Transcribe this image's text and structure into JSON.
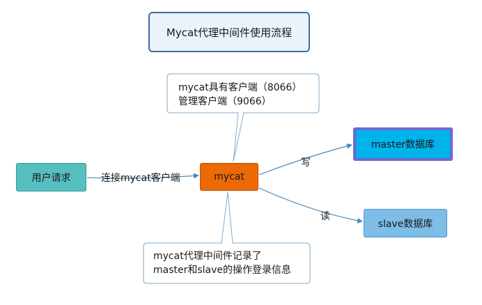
{
  "title": "Mycat代理中间件使用流程",
  "nodes": {
    "user": "用户请求",
    "mycat": "mycat",
    "master": "master数据库",
    "slave": "slave数据库"
  },
  "edges": {
    "user_to_mycat": "连接mycat客户端",
    "to_master": "写",
    "to_slave": "读"
  },
  "callouts": {
    "top": [
      "mycat具有客户端（8066）",
      "管理客户端（9066）"
    ],
    "bottom": [
      "mycat代理中间件记录了",
      "master和slave的操作登录信息"
    ]
  },
  "colors": {
    "title_border": "#3e6d99",
    "user_fill": "#56bfc0",
    "mycat_fill": "#ec6a05",
    "master_fill": "#00b3ea",
    "master_border": "#6a6ad0",
    "slave_fill": "#7dbde8",
    "connector": "#4a8ab8",
    "callout_border": "#7faac9"
  }
}
